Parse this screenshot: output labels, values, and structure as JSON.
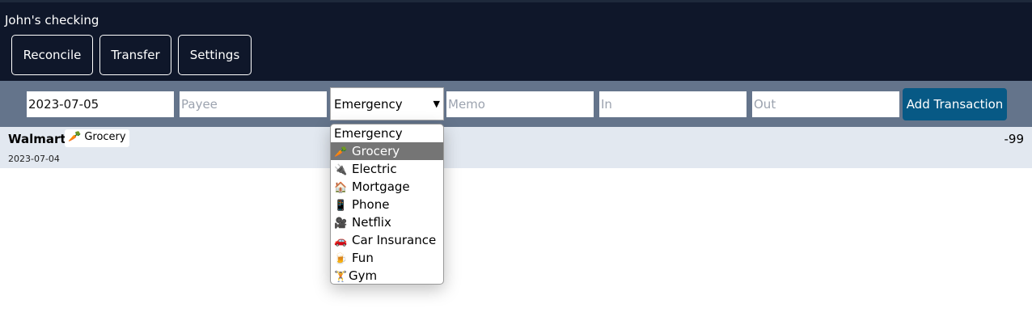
{
  "header": {
    "title": "John's checking",
    "buttons": [
      "Reconcile",
      "Transfer",
      "Settings"
    ]
  },
  "form": {
    "date_value": "2023-07-05",
    "payee_placeholder": "Payee",
    "category_selected": "Emergency",
    "memo_placeholder": "Memo",
    "in_placeholder": "In",
    "out_placeholder": "Out",
    "add_label": "Add Transaction",
    "add_color": "#075985"
  },
  "transactions": [
    {
      "payee": "Walmart",
      "category_icon": "🥕",
      "category": "Grocery",
      "date": "2023-07-04",
      "amount": "-99"
    }
  ],
  "dropdown": {
    "highlighted": "Grocery",
    "options": [
      {
        "icon": "",
        "label": "Emergency"
      },
      {
        "icon": "🥕",
        "label": "Grocery"
      },
      {
        "icon": "🔌",
        "label": "Electric"
      },
      {
        "icon": "🏠",
        "label": "Mortgage"
      },
      {
        "icon": "📱",
        "label": "Phone"
      },
      {
        "icon": "🎥",
        "label": "Netflix"
      },
      {
        "icon": "🚗",
        "label": "Car Insurance"
      },
      {
        "icon": "🍺",
        "label": "Fun"
      },
      {
        "icon": "🏋",
        "label": "Gym"
      }
    ]
  }
}
